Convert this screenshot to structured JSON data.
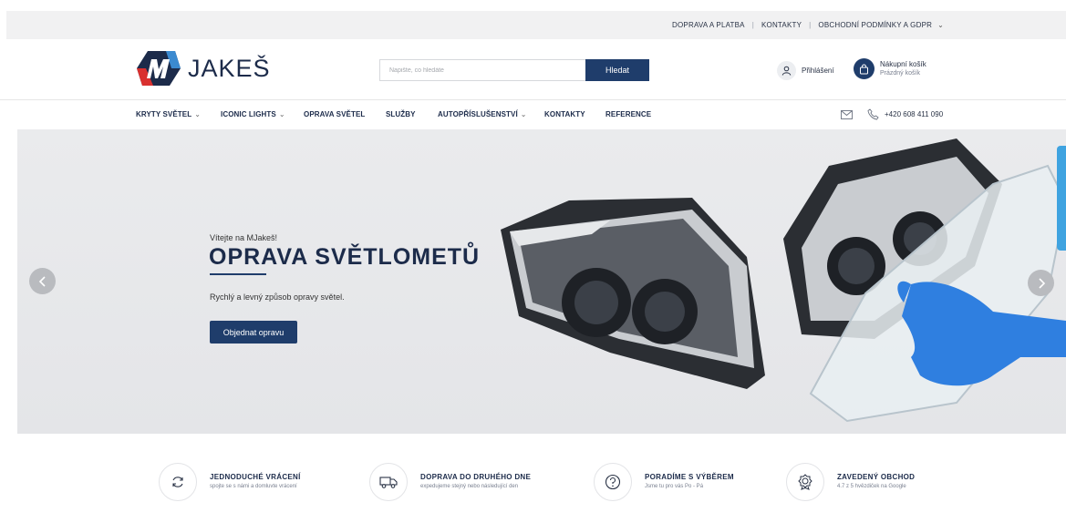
{
  "topbar": {
    "links": [
      "DOPRAVA A PLATBA",
      "KONTAKTY",
      "OBCHODNÍ PODMÍNKY A GDPR"
    ]
  },
  "header": {
    "logo_text": "JAKEŠ",
    "search_placeholder": "Napište, co hledáte",
    "search_button": "Hledat",
    "login_label": "Přihlášení",
    "cart_title": "Nákupní košík",
    "cart_status": "Prázdný košík"
  },
  "nav": {
    "items": [
      {
        "label": "KRYTY SVĚTEL",
        "dropdown": true
      },
      {
        "label": "ICONIC LIGHTS",
        "dropdown": true
      },
      {
        "label": "OPRAVA SVĚTEL",
        "dropdown": false
      },
      {
        "label": "SLUŽBY",
        "dropdown": false
      },
      {
        "label": "AUTOPŘÍSLUŠENSTVÍ",
        "dropdown": true
      },
      {
        "label": "KONTAKTY",
        "dropdown": false
      },
      {
        "label": "REFERENCE",
        "dropdown": false
      }
    ],
    "phone": "+420 608 411 090"
  },
  "hero": {
    "welcome": "Vítejte na MJakeš!",
    "title": "OPRAVA SVĚTLOMETŮ",
    "description": "Rychlý a levný způsob opravy světel.",
    "cta": "Objednat opravu"
  },
  "features": [
    {
      "icon": "return-icon",
      "title": "JEDNODUCHÉ VRÁCENÍ",
      "subtitle": "spojte se s námi a domluvte vrácení"
    },
    {
      "icon": "truck-icon",
      "title": "DOPRAVA DO DRUHÉHO DNE",
      "subtitle": "expedujeme stejný nebo následující den"
    },
    {
      "icon": "question-icon",
      "title": "PORADÍME S VÝBĚREM",
      "subtitle": "Jsme tu pro vás Po - Pá"
    },
    {
      "icon": "badge-icon",
      "title": "ZAVEDENÝ OBCHOD",
      "subtitle": "4.7 z 5 hvězdiček na Google"
    }
  ],
  "colors": {
    "brand": "#1f3d6b",
    "topbar_bg": "#f1f1f2",
    "hero_bg": "#e6e7ea",
    "side_tab": "#3fa3e0"
  }
}
